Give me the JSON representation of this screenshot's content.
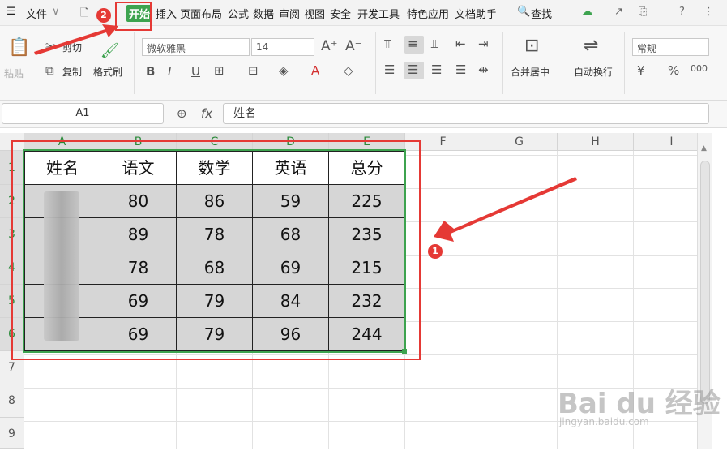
{
  "menubar": {
    "file_menu": "文件",
    "tabs": [
      "开始",
      "插入",
      "页面布局",
      "公式",
      "数据",
      "审阅",
      "视图",
      "安全",
      "开发工具",
      "特色应用",
      "文档助手"
    ],
    "search": "查找"
  },
  "ribbon": {
    "paste": "粘贴",
    "cut": "剪切",
    "copy": "复制",
    "format_painter": "格式刷",
    "font_name": "微软雅黑",
    "font_size": "14",
    "merge_center": "合并居中",
    "wrap_text": "自动换行",
    "number_format": "常规"
  },
  "formula_bar": {
    "name_box": "A1",
    "fx_label": "fx",
    "value": "姓名"
  },
  "columns": [
    "A",
    "B",
    "C",
    "D",
    "E",
    "F",
    "G",
    "H",
    "I"
  ],
  "rows": [
    "1",
    "2",
    "3",
    "4",
    "5",
    "6",
    "7",
    "8",
    "9"
  ],
  "table": {
    "header": [
      "姓名",
      "语文",
      "数学",
      "英语",
      "总分"
    ],
    "rows": [
      [
        "",
        "80",
        "86",
        "59",
        "225"
      ],
      [
        "",
        "89",
        "78",
        "68",
        "235"
      ],
      [
        "",
        "78",
        "68",
        "69",
        "215"
      ],
      [
        "",
        "69",
        "79",
        "84",
        "232"
      ],
      [
        "",
        "69",
        "79",
        "96",
        "244"
      ]
    ]
  },
  "annotations": {
    "badge1": "1",
    "badge2": "2",
    "accent": "#e53935"
  },
  "watermark": {
    "text": "Bai du 经验",
    "url": "jingyan.baidu.com"
  }
}
